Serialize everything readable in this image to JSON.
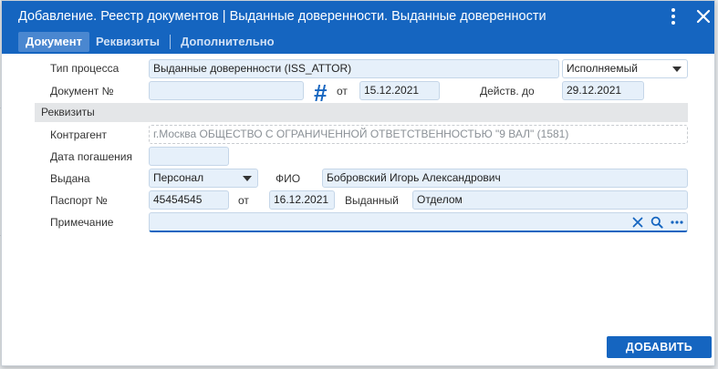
{
  "dialog": {
    "title": "Добавление. Реестр документов | Выданные доверенности. Выданные доверенности",
    "menu_icon": "more-vertical-icon",
    "close_icon": "close-icon",
    "accent_color": "#1565c0"
  },
  "tabs": [
    {
      "label": "Документ",
      "active": true
    },
    {
      "label": "Реквизиты",
      "active": false
    },
    {
      "label": "Дополнительно",
      "active": false
    }
  ],
  "form": {
    "process_type_label": "Тип процесса",
    "process_type_value": "Выданные доверенности (ISS_ATTOR)",
    "status_value": "Исполняемый",
    "doc_number_label": "Документ №",
    "doc_number_value": "",
    "date_from_label": "от",
    "date_from_value": "15.12.2021",
    "valid_until_label": "Действ. до",
    "valid_until_value": "29.12.2021"
  },
  "requisites": {
    "section_label": "Реквизиты",
    "counterparty_label": "Контрагент",
    "counterparty_value": "г.Москва ОБЩЕСТВО С ОГРАНИЧЕННОЙ ОТВЕТСТВЕННОСТЬЮ \"9 ВАЛ\" (1581)",
    "repayment_date_label": "Дата погашения",
    "repayment_date_value": "",
    "issued_to_label": "Выдана",
    "issued_to_value": "Персонал",
    "fio_label": "ФИО",
    "fio_value": "Бобровский Игорь Александрович",
    "passport_label": "Паспорт №",
    "passport_value": "45454545",
    "passport_from_label": "от",
    "passport_date_value": "16.12.2021",
    "issued_by_label": "Выданный",
    "issued_by_value": "Отделом",
    "note_label": "Примечание",
    "note_value": ""
  },
  "footer": {
    "add_button_label": "ДОБАВИТЬ"
  }
}
